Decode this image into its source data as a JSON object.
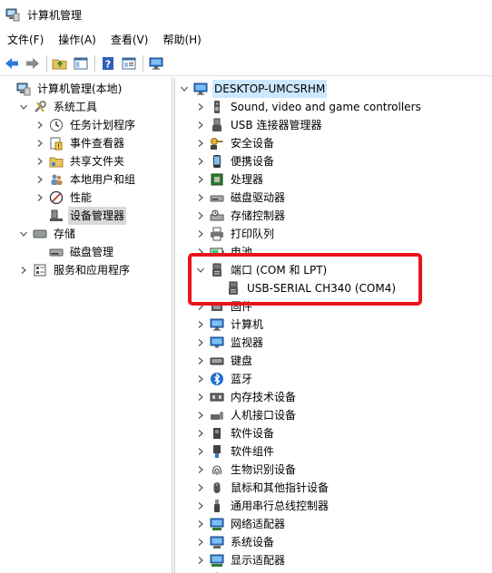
{
  "window": {
    "title": "计算机管理"
  },
  "menubar": [
    "文件(F)",
    "操作(A)",
    "查看(V)",
    "帮助(H)"
  ],
  "toolbar": [
    "back-icon",
    "forward-icon",
    "up-folder-icon",
    "show-hide-tree-icon",
    "help-icon",
    "properties-icon",
    "monitor-icon"
  ],
  "left_tree": [
    {
      "label": "计算机管理(本地)",
      "icon": "computer-management-icon",
      "arrow": "",
      "level": 0
    },
    {
      "label": "系统工具",
      "icon": "tools-icon",
      "arrow": "expanded",
      "level": 1
    },
    {
      "label": "任务计划程序",
      "icon": "clock-icon",
      "arrow": "collapsed",
      "level": 2
    },
    {
      "label": "事件查看器",
      "icon": "event-viewer-icon",
      "arrow": "collapsed",
      "level": 2
    },
    {
      "label": "共享文件夹",
      "icon": "shared-folder-icon",
      "arrow": "collapsed",
      "level": 2
    },
    {
      "label": "本地用户和组",
      "icon": "users-icon",
      "arrow": "collapsed",
      "level": 2
    },
    {
      "label": "性能",
      "icon": "performance-icon",
      "arrow": "collapsed",
      "level": 2
    },
    {
      "label": "设备管理器",
      "icon": "device-manager-icon",
      "arrow": "",
      "level": 2,
      "selected": true
    },
    {
      "label": "存储",
      "icon": "storage-icon",
      "arrow": "expanded",
      "level": 1
    },
    {
      "label": "磁盘管理",
      "icon": "disk-icon",
      "arrow": "",
      "level": 2
    },
    {
      "label": "服务和应用程序",
      "icon": "services-icon",
      "arrow": "collapsed",
      "level": 1
    }
  ],
  "right_tree": [
    {
      "label": "DESKTOP-UMCSRHM",
      "icon": "computer-icon",
      "arrow": "expanded",
      "level": 0,
      "root": true
    },
    {
      "label": "Sound, video and game controllers",
      "icon": "speaker-icon",
      "arrow": "collapsed",
      "level": 1
    },
    {
      "label": "USB 连接器管理器",
      "icon": "usb-icon",
      "arrow": "collapsed",
      "level": 1
    },
    {
      "label": "安全设备",
      "icon": "security-key-icon",
      "arrow": "collapsed",
      "level": 1
    },
    {
      "label": "便携设备",
      "icon": "portable-device-icon",
      "arrow": "collapsed",
      "level": 1
    },
    {
      "label": "处理器",
      "icon": "processor-icon",
      "arrow": "collapsed",
      "level": 1
    },
    {
      "label": "磁盘驱动器",
      "icon": "disk-drive-icon",
      "arrow": "collapsed",
      "level": 1
    },
    {
      "label": "存储控制器",
      "icon": "storage-controller-icon",
      "arrow": "collapsed",
      "level": 1
    },
    {
      "label": "打印队列",
      "icon": "printer-icon",
      "arrow": "collapsed",
      "level": 1
    },
    {
      "label": "电池",
      "icon": "battery-icon",
      "arrow": "collapsed",
      "level": 1
    },
    {
      "label": "端口 (COM 和 LPT)",
      "icon": "port-icon",
      "arrow": "expanded",
      "level": 1
    },
    {
      "label": "USB-SERIAL CH340 (COM4)",
      "icon": "port-icon",
      "arrow": "",
      "level": 2
    },
    {
      "label": "固件",
      "icon": "firmware-icon",
      "arrow": "collapsed",
      "level": 1
    },
    {
      "label": "计算机",
      "icon": "computer-icon",
      "arrow": "collapsed",
      "level": 1
    },
    {
      "label": "监视器",
      "icon": "monitor-icon",
      "arrow": "collapsed",
      "level": 1
    },
    {
      "label": "键盘",
      "icon": "keyboard-icon",
      "arrow": "collapsed",
      "level": 1
    },
    {
      "label": "蓝牙",
      "icon": "bluetooth-icon",
      "arrow": "collapsed",
      "level": 1
    },
    {
      "label": "内存技术设备",
      "icon": "memory-icon",
      "arrow": "collapsed",
      "level": 1
    },
    {
      "label": "人机接口设备",
      "icon": "hid-icon",
      "arrow": "collapsed",
      "level": 1
    },
    {
      "label": "软件设备",
      "icon": "software-device-icon",
      "arrow": "collapsed",
      "level": 1
    },
    {
      "label": "软件组件",
      "icon": "software-component-icon",
      "arrow": "collapsed",
      "level": 1
    },
    {
      "label": "生物识别设备",
      "icon": "fingerprint-icon",
      "arrow": "collapsed",
      "level": 1
    },
    {
      "label": "鼠标和其他指针设备",
      "icon": "mouse-icon",
      "arrow": "collapsed",
      "level": 1
    },
    {
      "label": "通用串行总线控制器",
      "icon": "usb-controller-icon",
      "arrow": "collapsed",
      "level": 1
    },
    {
      "label": "网络适配器",
      "icon": "network-adapter-icon",
      "arrow": "collapsed",
      "level": 1
    },
    {
      "label": "系统设备",
      "icon": "system-device-icon",
      "arrow": "collapsed",
      "level": 1
    },
    {
      "label": "显示适配器",
      "icon": "display-adapter-icon",
      "arrow": "collapsed",
      "level": 1
    },
    {
      "label": "",
      "icon": "audio-icon",
      "arrow": "collapsed",
      "level": 1
    }
  ],
  "colors": {
    "highlight_box": "#e8141b",
    "selection": "#d9d9d9",
    "root_selection": "#cce8ff"
  }
}
